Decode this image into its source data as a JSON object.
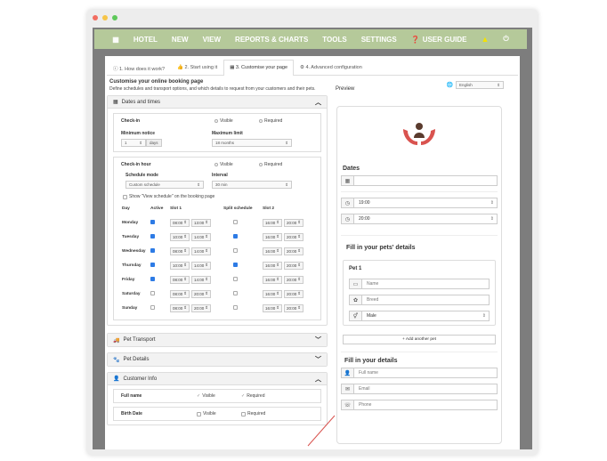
{
  "window": {
    "dots": [
      "#f26d60",
      "#f7c548",
      "#5ec95a"
    ]
  },
  "nav": {
    "grid_icon": "grid-icon",
    "items": [
      "HOTEL",
      "NEW",
      "VIEW",
      "REPORTS & CHARTS",
      "TOOLS",
      "SETTINGS"
    ],
    "user_guide": "USER GUIDE",
    "bg": "#b5c99a"
  },
  "tabs": [
    "1. How does it work?",
    "2. Start using it",
    "3. Customise your page",
    "4. Advanced configuration"
  ],
  "page": {
    "title": "Customise your online booking page",
    "subtitle": "Define schedules and transport options, and which details to request from your customers and their pets."
  },
  "dates_panel": {
    "title": "Dates and times",
    "checkin": {
      "label": "Check-in",
      "visible": "Visible",
      "required": "Required"
    },
    "min_notice": {
      "label": "Minimum notice",
      "value": "1",
      "unit": "days"
    },
    "max_limit": {
      "label": "Maximum limit",
      "value": "18 months"
    },
    "checkin_hour": {
      "label": "Check-in hour",
      "visible": "Visible",
      "required": "Required"
    },
    "schedule_mode": {
      "label": "Schedule mode",
      "value": "Custom schedule"
    },
    "interval": {
      "label": "Interval",
      "value": "30 min"
    },
    "show_schedule": "Show \"View schedule\" on the booking page",
    "headers": {
      "day": "Day",
      "active": "Active",
      "slot1": "Slot 1",
      "split": "Split schedule",
      "slot2": "Slot 2"
    },
    "days": [
      {
        "name": "Monday",
        "s1a": "08:00",
        "s1b": "13:00",
        "s2a": "16:00",
        "s2b": "20:00"
      },
      {
        "name": "Tuesday",
        "s1a": "10:00",
        "s1b": "14:00",
        "s2a": "16:00",
        "s2b": "20:00"
      },
      {
        "name": "Wednesday",
        "s1a": "08:00",
        "s1b": "14:00",
        "s2a": "16:00",
        "s2b": "20:00"
      },
      {
        "name": "Thursday",
        "s1a": "10:00",
        "s1b": "14:00",
        "s2a": "16:00",
        "s2b": "20:00"
      },
      {
        "name": "Friday",
        "s1a": "08:00",
        "s1b": "14:00",
        "s2a": "16:00",
        "s2b": "20:00"
      },
      {
        "name": "Saturday",
        "s1a": "08:00",
        "s1b": "20:00",
        "s2a": "16:00",
        "s2b": "20:00"
      },
      {
        "name": "Sunday",
        "s1a": "08:00",
        "s1b": "20:00",
        "s2a": "16:00",
        "s2b": "20:00"
      }
    ]
  },
  "pet_transport": {
    "title": "Pet Transport"
  },
  "pet_details": {
    "title": "Pet Details"
  },
  "customer_info": {
    "title": "Customer Info",
    "full_name": {
      "label": "Full name",
      "visible": "Visible",
      "required": "Required"
    },
    "birth_date": {
      "label": "Birth Date",
      "visible": "Visible",
      "required": "Required"
    }
  },
  "preview": {
    "label": "Preview",
    "language": "English",
    "dates_title": "Dates",
    "time1": "19:00",
    "time2": "20:00",
    "pets_title": "Fill in your pets' details",
    "pet1": "Pet 1",
    "name_ph": "Name",
    "breed_ph": "Breed",
    "sex_value": "Male",
    "add_pet": "+ Add another pet",
    "details_title": "Fill in your details",
    "fullname_ph": "Full name",
    "email_ph": "Email",
    "phone_ph": "Phone",
    "logo_color": "#d9534f"
  }
}
